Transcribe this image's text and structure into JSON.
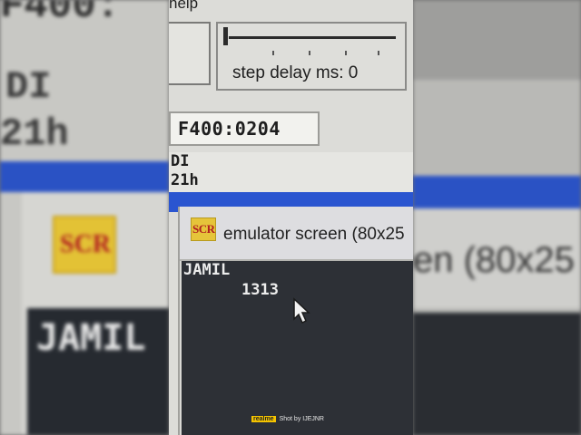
{
  "menu": {
    "help_label": "help"
  },
  "toolbar": {
    "step_delay_label": "step delay ms: 0"
  },
  "address": {
    "value": "F400:0204"
  },
  "registers": {
    "name": "DI",
    "value": "21h"
  },
  "emulator": {
    "icon_text": "SCR",
    "title": "emulator screen (80x25",
    "output_line1": "JAMIL",
    "output_line2": "1313"
  },
  "background": {
    "left_top_fragment": "F400:",
    "left_reg_name": "DI",
    "left_reg_value": "21h",
    "left_output": "JAMIL",
    "right_title_fragment": "en (80x25"
  },
  "watermark": {
    "badge": "realme",
    "text": "Shot by IJEJNR"
  }
}
